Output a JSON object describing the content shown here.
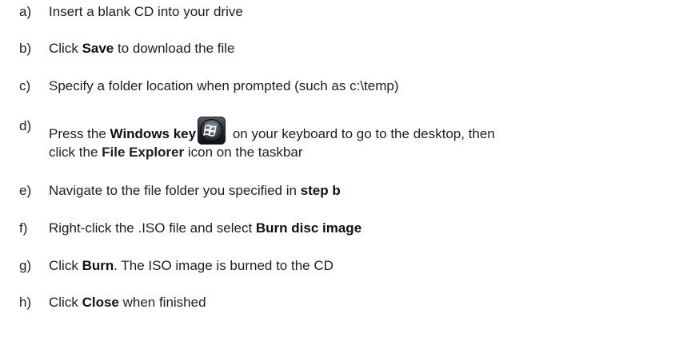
{
  "steps": [
    {
      "marker": "a)",
      "parts": [
        {
          "t": "Insert a blank CD into your drive"
        }
      ]
    },
    {
      "marker": "b)",
      "parts": [
        {
          "t": "Click "
        },
        {
          "b": "Save"
        },
        {
          "t": " to download the file"
        }
      ]
    },
    {
      "marker": "c)",
      "parts": [
        {
          "t": "Specify a folder location when prompted (such as c:\\temp)"
        }
      ]
    },
    {
      "marker": "d)",
      "line1_pre": "Press the ",
      "line1_bold": "Windows key",
      "line1_post": " on your keyboard to go to the desktop, then",
      "line2_pre": "click the ",
      "line2_bold": "File Explorer",
      "line2_post": " icon on the taskbar",
      "icon": "windows-key-icon"
    },
    {
      "marker": "e)",
      "parts": [
        {
          "t": "Navigate to the file folder you specified in "
        },
        {
          "b": "step b"
        }
      ]
    },
    {
      "marker": "f)",
      "parts": [
        {
          "t": "Right-click the .ISO file and select "
        },
        {
          "b": "Burn disc image"
        }
      ]
    },
    {
      "marker": "g)",
      "parts": [
        {
          "t": "Click "
        },
        {
          "b": "Burn"
        },
        {
          "t": ". The ISO image is burned to the CD"
        }
      ]
    },
    {
      "marker": "h)",
      "parts": [
        {
          "t": "Click "
        },
        {
          "b": "Close"
        },
        {
          "t": " when finished"
        }
      ]
    }
  ]
}
